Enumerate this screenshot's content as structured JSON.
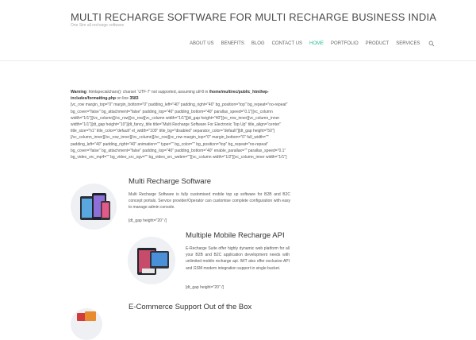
{
  "site": {
    "title": "MULTI RECHARGE SOFTWARE FOR MULTI RECHARGE BUSINESS INDIA",
    "tagline": "One Sim all recharge software"
  },
  "nav": {
    "items": [
      {
        "label": "ABOUT US"
      },
      {
        "label": "BENEFITS"
      },
      {
        "label": "BLOG"
      },
      {
        "label": "CONTACT US"
      },
      {
        "label": "HOME",
        "active": true
      },
      {
        "label": "PORTFOLIO"
      },
      {
        "label": "PRODUCT"
      },
      {
        "label": "SERVICES"
      }
    ],
    "search_icon": "search-icon",
    "active_color": "#2dbd9a"
  },
  "notice": {
    "warning_label": "Warning",
    "warning_msg": ": htmlspecialchars(): charset `UTF-7' not supported, assuming utf-8 in ",
    "path": "/home/multirec/public_html/wp-includes/formatting.php",
    "line_prefix": " on line ",
    "line": "3583",
    "shortcode": "[vc_row margin_top=\"0\" margin_bottom=\"0\" padding_left=\"40\" padding_right=\"40\" bg_position=\"top\" bg_repeat=\"no-repeat\" bg_cover=\"false\" bg_attachment=\"false\" padding_top=\"40\" padding_bottom=\"40\" parallax_speed=\"0.1\"][vc_column width=\"1/1\"][/vc_column][/vc_row][vc_row][vc_column width=\"1/1\"][dt_gap height=\"40\"][vc_row_inner][vc_column_inner width=\"1/1\"][dt_gap height=\"10\"][dt_fancy_title title=\"Multi Recharge Software For Electronic Top Up\" title_align=\"center\" title_size=\"h1\" title_color=\"default\" el_width=\"100\" title_bg=\"disabled\" separator_color=\"default\"][dt_gap height=\"50\"][/vc_column_inner][/vc_row_inner][/vc_column][/vc_row][vc_row margin_top=\"0\" margin_bottom=\"0\" full_width=\"\" padding_left=\"40\" padding_right=\"40\" animation=\"\" type=\"\" bg_color=\"\" bg_position=\"top\" bg_repeat=\"no-repeat\" bg_cover=\"false\" bg_attachment=\"false\" padding_top=\"40\" padding_bottom=\"40\" enable_parallax=\"\" parallax_speed=\"0.1\" bg_video_src_mp4=\"\" bg_video_src_ogv=\"\" bg_video_src_webm=\"\"][vc_column width=\"1/2\"][vc_column_inner width=\"1/1\"]"
  },
  "features": [
    {
      "title": "Multi Recharge Software",
      "text": "Multi Recharge Software is fully customised mobile top up software for B2B and B2C concept portals. Service provider/Operator can customise complete configuration with easy to manage admin console.",
      "gap": "[dt_gap height=\"20\" /]"
    },
    {
      "title": "Multiple Mobile Recharge API",
      "text": "E-Recharge Suite offer highly dynamic web platform for all your B2B and B2C application development needs with unlimited mobile recharge api. IWT also offer exclusive API and GSM modem integration support in single bucket.",
      "gap": "[dt_gap height=\"20\" /]"
    },
    {
      "title": "E-Commerce Support Out of the Box"
    }
  ]
}
